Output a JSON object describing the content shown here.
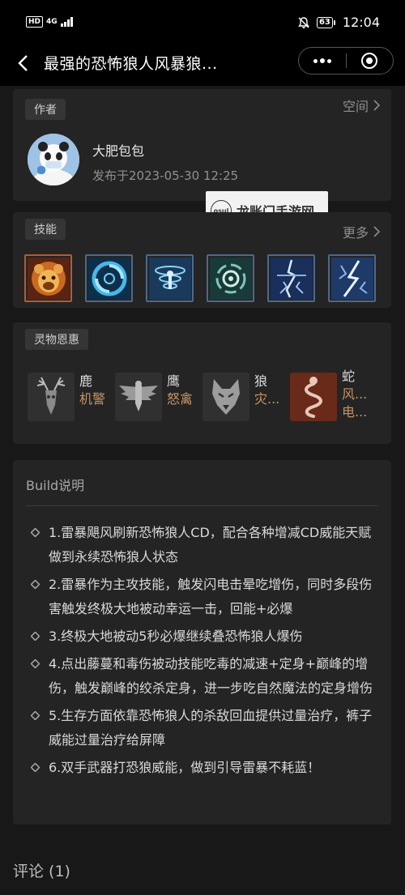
{
  "status_bar": {
    "hd": "HD",
    "signal": "4G",
    "battery": "63",
    "time": "12:04"
  },
  "nav": {
    "title": "最强的恐怖狼人风暴狼..."
  },
  "author": {
    "tag": "作者",
    "link": "空间",
    "name": "大肥包包",
    "date": "发布于2023-05-30 12:25"
  },
  "watermark": {
    "logo": "osul",
    "text": "龙账门手游网"
  },
  "skills": {
    "tag": "技能",
    "link": "更多",
    "icons": [
      "bear-skill-icon",
      "vortex-skill-icon",
      "tornado-skill-icon",
      "swirl-skill-icon",
      "lightning-strike-skill-icon",
      "storm-skill-icon"
    ]
  },
  "spirits": {
    "tag": "灵物恩惠",
    "items": [
      {
        "name": "鹿",
        "ability": "机警",
        "icon": "deer-icon"
      },
      {
        "name": "鹰",
        "ability": "怒禽",
        "icon": "eagle-icon"
      },
      {
        "name": "狼",
        "ability": "灾...",
        "icon": "wolf-icon"
      },
      {
        "name": "蛇",
        "ability": "风...",
        "ability2": "电...",
        "icon": "snake-icon"
      }
    ]
  },
  "build": {
    "title": "Build说明",
    "items": [
      "1.雷暴飓风刷新恐怖狼人CD，配合各种增减CD威能天赋做到永续恐怖狼人状态",
      "2.雷暴作为主攻技能，触发闪电击晕吃增伤，同时多段伤害触发终极大地被动幸运一击，回能+必爆",
      "3.终极大地被动5秒必爆继续叠恐怖狼人爆伤",
      "4.点出藤蔓和毒伤被动技能吃毒的减速+定身+巅峰的增伤，触发巅峰的绞杀定身，进一步吃自然魔法的定身增伤",
      "5.生存方面依靠恐怖狼人的杀敌回血提供过量治疗，裤子威能过量治疗给屏障",
      "6.双手武器打恐狼威能，做到引导雷暴不耗蓝！"
    ]
  },
  "comments": {
    "title": "评论 (1)"
  }
}
